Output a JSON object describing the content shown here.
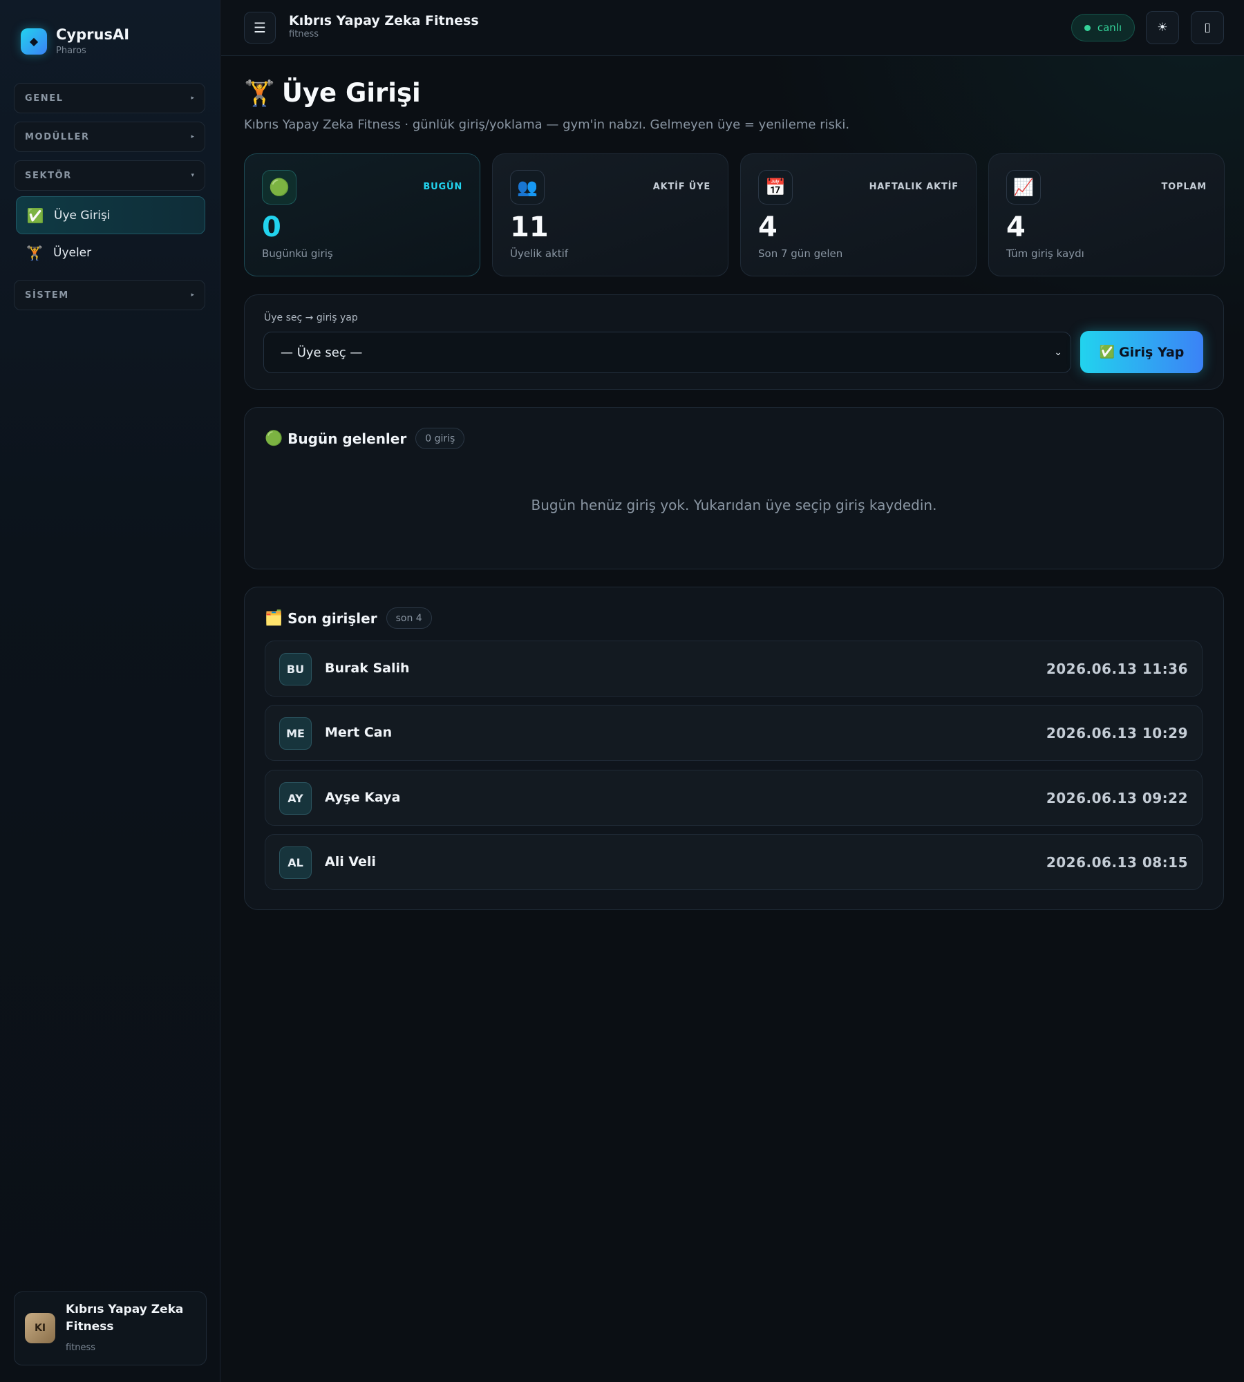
{
  "brand": {
    "name": "CyprusAI",
    "sub": "Pharos",
    "logo_icon": "◆"
  },
  "sidebar": {
    "groups": [
      {
        "label": "GENEL",
        "arrow": "▸"
      },
      {
        "label": "MODÜLLER",
        "arrow": "▸"
      },
      {
        "label": "SEKTÖR",
        "arrow": "▾"
      },
      {
        "label": "SİSTEM",
        "arrow": "▸"
      }
    ],
    "items": [
      {
        "icon": "✅",
        "label": "Üye Girişi",
        "active": true
      },
      {
        "icon": "🏋️",
        "label": "Üyeler",
        "active": false
      }
    ],
    "org": {
      "initials": "KI",
      "name": "Kıbrıs Yapay Zeka Fitness",
      "sub": "fitness"
    }
  },
  "topbar": {
    "menu_icon": "☰",
    "title": "Kıbrıs Yapay Zeka Fitness",
    "sub": "fitness",
    "status": "canlı",
    "theme_icon": "☀",
    "device_icon": "▯"
  },
  "page": {
    "icon": "🏋️",
    "title": "Üye Girişi",
    "description": "Kıbrıs Yapay Zeka Fitness · günlük giriş/yoklama — gym'in nabzı. Gelmeyen üye = yenileme riski."
  },
  "stats": [
    {
      "icon": "🟢",
      "label": "BUGÜN",
      "value": "0",
      "sub": "Bugünkü giriş"
    },
    {
      "icon": "👥",
      "label": "AKTİF ÜYE",
      "value": "11",
      "sub": "Üyelik aktif"
    },
    {
      "icon": "📅",
      "label": "HAFTALIK AKTİF",
      "value": "4",
      "sub": "Son 7 gün gelen"
    },
    {
      "icon": "📈",
      "label": "TOPLAM",
      "value": "4",
      "sub": "Tüm giriş kaydı"
    }
  ],
  "checkin": {
    "label": "Üye seç → giriş yap",
    "select_value": "— Üye seç —",
    "chevron": "⌄",
    "button_icon": "✅",
    "button_label": "Giriş Yap"
  },
  "today": {
    "icon": "🟢",
    "title": "Bugün gelenler",
    "count": "0 giriş",
    "empty": "Bugün henüz giriş yok. Yukarıdan üye seçip giriş kaydedin."
  },
  "recent": {
    "icon": "🗂️",
    "title": "Son girişler",
    "count": "son 4",
    "rows": [
      {
        "initials": "BU",
        "name": "Burak Salih",
        "time": "2026.06.13 11:36"
      },
      {
        "initials": "ME",
        "name": "Mert Can",
        "time": "2026.06.13 10:29"
      },
      {
        "initials": "AY",
        "name": "Ayşe Kaya",
        "time": "2026.06.13 09:22"
      },
      {
        "initials": "AL",
        "name": "Ali Veli",
        "time": "2026.06.13 08:15"
      }
    ]
  }
}
